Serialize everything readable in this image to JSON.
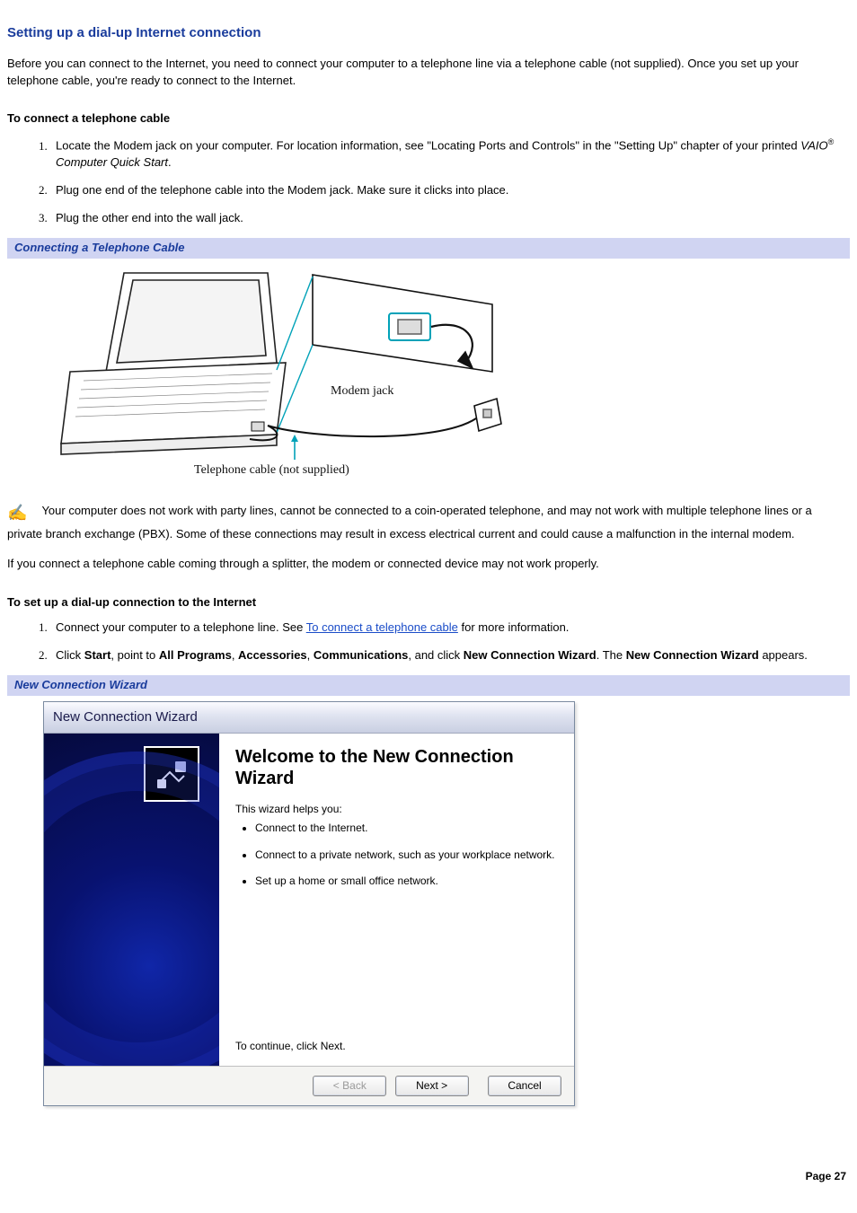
{
  "heading": "Setting up a dial-up Internet connection",
  "intro": "Before you can connect to the Internet, you need to connect your computer to a telephone line via a telephone cable (not supplied). Once you set up your telephone cable, you're ready to connect to the Internet.",
  "sub1": "To connect a telephone cable",
  "steps1": {
    "s1a": "Locate the Modem jack on your computer. For location information, see \"Locating Ports and Controls\" in the \"Setting Up\" chapter of your printed ",
    "s1b_italic": "VAIO",
    "s1b_reg": "®",
    "s1c_italic": " Computer Quick Start",
    "s1d": ".",
    "s2": "Plug one end of the telephone cable into the Modem jack. Make sure it clicks into place.",
    "s3": "Plug the other end into the wall jack."
  },
  "figtitle1": "Connecting a Telephone Cable",
  "diagram": {
    "modem_label": "Modem jack",
    "cable_label": "Telephone cable (not supplied)"
  },
  "note1": "Your computer does not work with party lines, cannot be connected to a coin-operated telephone, and may not work with multiple telephone lines or a private branch exchange (PBX). Some of these connections may result in excess electrical current and could cause a malfunction in the internal modem.",
  "note2": "If you connect a telephone cable coming through a splitter, the modem or connected device may not work properly.",
  "sub2": "To set up a dial-up connection to the Internet",
  "steps2": {
    "s1a": "Connect your computer to a telephone line. See ",
    "s1_link": "To connect a telephone cable",
    "s1b": " for more information.",
    "s2a": "Click ",
    "s2_start": "Start",
    "s2b": ", point to ",
    "s2_ap": "All Programs",
    "s2c": ", ",
    "s2_acc": "Accessories",
    "s2d": ", ",
    "s2_comm": "Communications",
    "s2e": ", and click ",
    "s2_ncw": "New Connection Wizard",
    "s2f": ". The ",
    "s2_ncw2": "New Connection Wizard",
    "s2g": " appears."
  },
  "figtitle2": "New Connection Wizard",
  "wizard": {
    "title": "New Connection Wizard",
    "h1": "Welcome to the New Connection Wizard",
    "helps": "This wizard helps you:",
    "b1": "Connect to the Internet.",
    "b2": "Connect to a private network, such as your workplace network.",
    "b3": "Set up a home or small office network.",
    "cont": "To continue, click Next.",
    "back": "< Back",
    "next": "Next >",
    "cancel": "Cancel"
  },
  "pagenum": "Page 27"
}
